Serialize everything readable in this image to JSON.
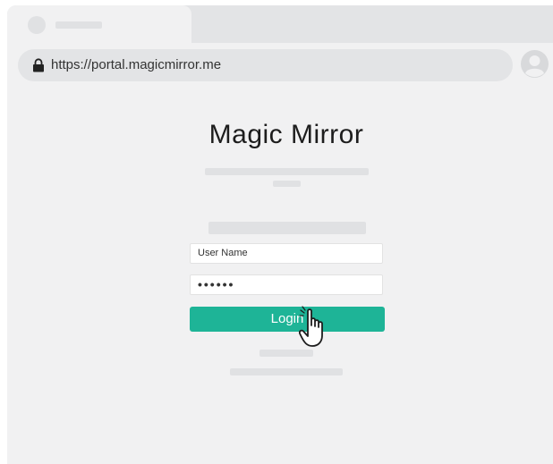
{
  "browser": {
    "address_bar": {
      "url": "https://portal.magicmirror.me"
    },
    "icons": {
      "lock": "lock-icon",
      "account": "account-icon"
    }
  },
  "page": {
    "logo_text": "Magic Mirror",
    "username_field": {
      "value": "User Name"
    },
    "password_field": {
      "value": "••••••"
    },
    "login_button": {
      "label": "Login"
    },
    "cursor": "hand-pointer-icon"
  },
  "colors": {
    "accent": "#1eb497",
    "background": "#f1f1f2",
    "placeholder": "#e0e1e3"
  }
}
